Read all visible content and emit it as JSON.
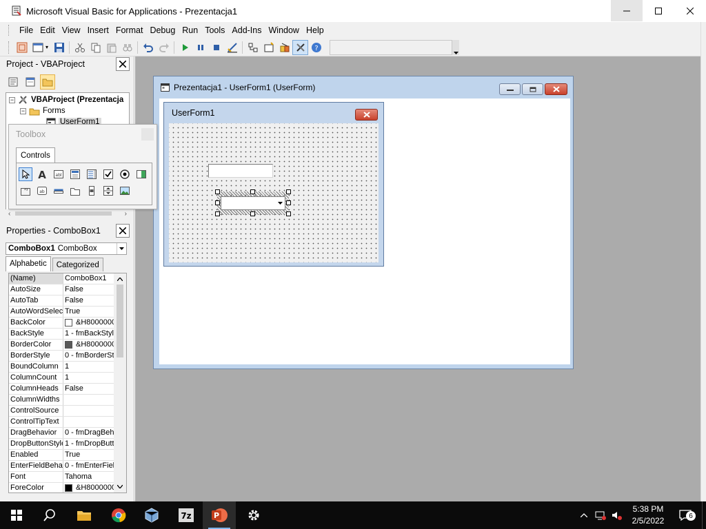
{
  "window": {
    "title": "Microsoft Visual Basic for Applications - Prezentacja1"
  },
  "menu": {
    "items": [
      {
        "label": "File",
        "name": "file"
      },
      {
        "label": "Edit",
        "name": "edit"
      },
      {
        "label": "View",
        "name": "view"
      },
      {
        "label": "Insert",
        "name": "insert"
      },
      {
        "label": "Format",
        "name": "format"
      },
      {
        "label": "Debug",
        "name": "debug"
      },
      {
        "label": "Run",
        "name": "run"
      },
      {
        "label": "Tools",
        "name": "tools"
      },
      {
        "label": "Add-Ins",
        "name": "add-ins"
      },
      {
        "label": "Window",
        "name": "window"
      },
      {
        "label": "Help",
        "name": "help"
      }
    ]
  },
  "project": {
    "title": "Project - VBAProject",
    "tree": {
      "root": "VBAProject (Prezentacja",
      "forms_folder": "Forms",
      "form": "UserForm1"
    }
  },
  "toolbox": {
    "title": "Toolbox",
    "tab": "Controls",
    "tools": [
      "pointer",
      "label",
      "textbox",
      "combobox",
      "listbox",
      "checkbox",
      "optionbutton",
      "togglebutton",
      "frame",
      "commandbutton",
      "tabstrip",
      "multipage",
      "scrollbar",
      "spinbutton",
      "image"
    ]
  },
  "properties": {
    "title": "Properties - ComboBox1",
    "object_name": "ComboBox1",
    "object_type": "ComboBox",
    "tabs": {
      "alphabetic": "Alphabetic",
      "categorized": "Categorized"
    },
    "rows": [
      {
        "name": "(Name)",
        "value": "ComboBox1"
      },
      {
        "name": "AutoSize",
        "value": "False"
      },
      {
        "name": "AutoTab",
        "value": "False"
      },
      {
        "name": "AutoWordSelect",
        "value": "True"
      },
      {
        "name": "BackColor",
        "value": "&H8000000",
        "swatch": "#ffffff"
      },
      {
        "name": "BackStyle",
        "value": "1 - fmBackStyle"
      },
      {
        "name": "BorderColor",
        "value": "&H8000000",
        "swatch": "#5a5a5a"
      },
      {
        "name": "BorderStyle",
        "value": "0 - fmBorderSt"
      },
      {
        "name": "BoundColumn",
        "value": "1"
      },
      {
        "name": "ColumnCount",
        "value": "1"
      },
      {
        "name": "ColumnHeads",
        "value": "False"
      },
      {
        "name": "ColumnWidths",
        "value": ""
      },
      {
        "name": "ControlSource",
        "value": ""
      },
      {
        "name": "ControlTipText",
        "value": ""
      },
      {
        "name": "DragBehavior",
        "value": "0 - fmDragBeh"
      },
      {
        "name": "DropButtonStyle",
        "value": "1 - fmDropButt"
      },
      {
        "name": "Enabled",
        "value": "True"
      },
      {
        "name": "EnterFieldBehav",
        "value": "0 - fmEnterFiel"
      },
      {
        "name": "Font",
        "value": "Tahoma"
      },
      {
        "name": "ForeColor",
        "value": "&H8000000",
        "swatch": "#000000"
      }
    ]
  },
  "designer": {
    "title": "Prezentacja1 - UserForm1 (UserForm)",
    "form_caption": "UserForm1"
  },
  "taskbar": {
    "time": "5:38 PM",
    "date": "2/5/2022",
    "notifications": "6",
    "apps": [
      "file-explorer",
      "chrome",
      "virtualbox",
      "7zip",
      "powerpoint",
      "settings"
    ]
  },
  "colors": {
    "mdi_background": "#ababab",
    "form_chrome": "#c4d6ec",
    "taskbar": "#0b0b0b"
  }
}
